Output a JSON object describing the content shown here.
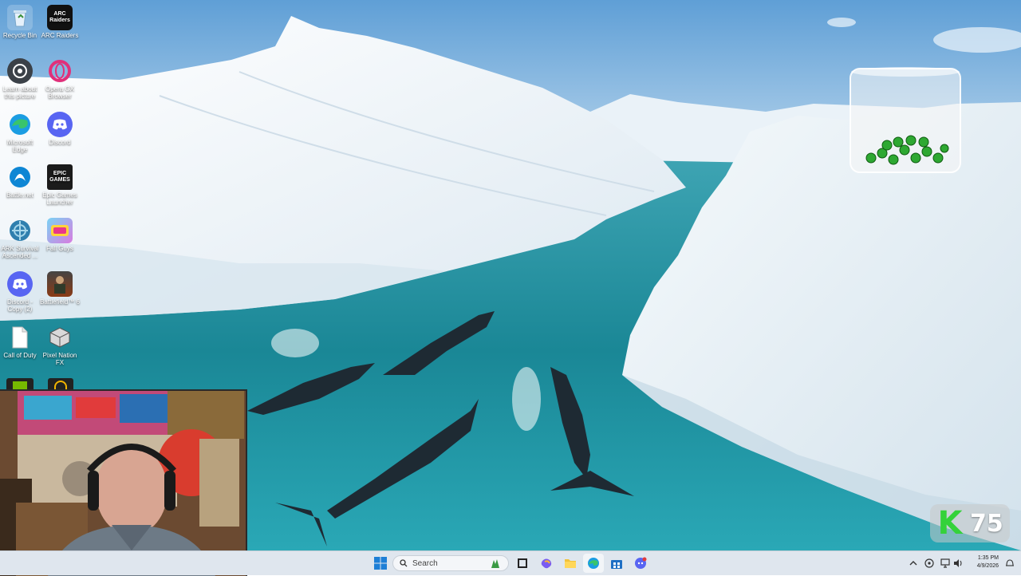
{
  "desktop": {
    "icons": [
      {
        "label": "Recycle Bin",
        "icon": "recycle-bin-icon"
      },
      {
        "label": "ARC Raiders",
        "icon": "arc-raiders-icon"
      },
      {
        "label": "Learn about this picture",
        "icon": "camera-icon"
      },
      {
        "label": "Opera GX Browser",
        "icon": "opera-gx-icon"
      },
      {
        "label": "Microsoft Edge",
        "icon": "edge-icon"
      },
      {
        "label": "Discord",
        "icon": "discord-icon"
      },
      {
        "label": "Battle.net",
        "icon": "battlenet-icon"
      },
      {
        "label": "Epic Games Launcher",
        "icon": "epic-games-icon"
      },
      {
        "label": "ARK Survival Ascended ...",
        "icon": "ark-icon"
      },
      {
        "label": "Fall Guys",
        "icon": "fall-guys-icon"
      },
      {
        "label": "Discord - Copy (2)",
        "icon": "discord-icon"
      },
      {
        "label": "Battlefield™ 6",
        "icon": "battlefield-icon"
      },
      {
        "label": "Call of Duty",
        "icon": "file-icon"
      },
      {
        "label": "Pixel Nation FX",
        "icon": "cube-icon"
      }
    ],
    "epic_logo_text": "EPIC GAMES",
    "arc_logo_text": "ARC Raiders"
  },
  "widget": {
    "counter_letter": "K",
    "counter_value": "75"
  },
  "taskbar": {
    "search_placeholder": "Search",
    "clock_time": "1:35 PM",
    "clock_date": "4/9/2026",
    "pinned": [
      "start-icon",
      "search-icon",
      "weather-icon",
      "task-view-icon",
      "copilot-icon",
      "file-explorer-icon",
      "edge-icon",
      "store-icon",
      "discord-icon"
    ],
    "tray": [
      "chevron-up-icon",
      "wifi-icon",
      "network-icon",
      "volume-icon"
    ]
  },
  "colors": {
    "ice": "#ffffff",
    "water": "#1f95a3",
    "taskbar": "#dfe6ee",
    "counter_green": "#34d23a"
  }
}
